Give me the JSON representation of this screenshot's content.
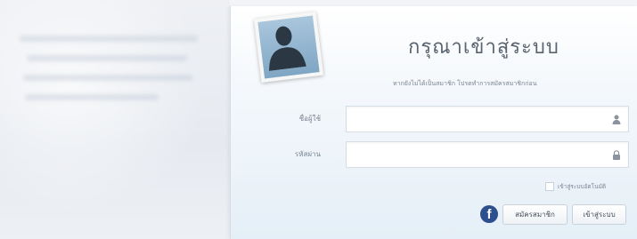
{
  "login": {
    "title": "กรุณาเข้าสู่ระบบ",
    "subtitle": "หากยังไม่ได้เป็นสมาชิก โปรดทำการสมัครสมาชิกก่อน",
    "username_label": "ชื่อผู้ใช้",
    "password_label": "รหัสผ่าน",
    "username_value": "",
    "password_value": "",
    "remember_label": "เข้าสู่ระบบอัตโนมัติ",
    "register_button": "สมัครสมาชิก",
    "login_button": "เข้าสู่ระบบ",
    "facebook_glyph": "f"
  },
  "icons": {
    "avatar": "person-silhouette-icon",
    "username_field_icon": "user-icon",
    "password_field_icon": "lock-icon",
    "facebook": "facebook-icon"
  },
  "colors": {
    "facebook_blue": "#2e4f8f",
    "title_text": "#5a6470",
    "panel_gradient_bottom": "#e5eff7"
  }
}
